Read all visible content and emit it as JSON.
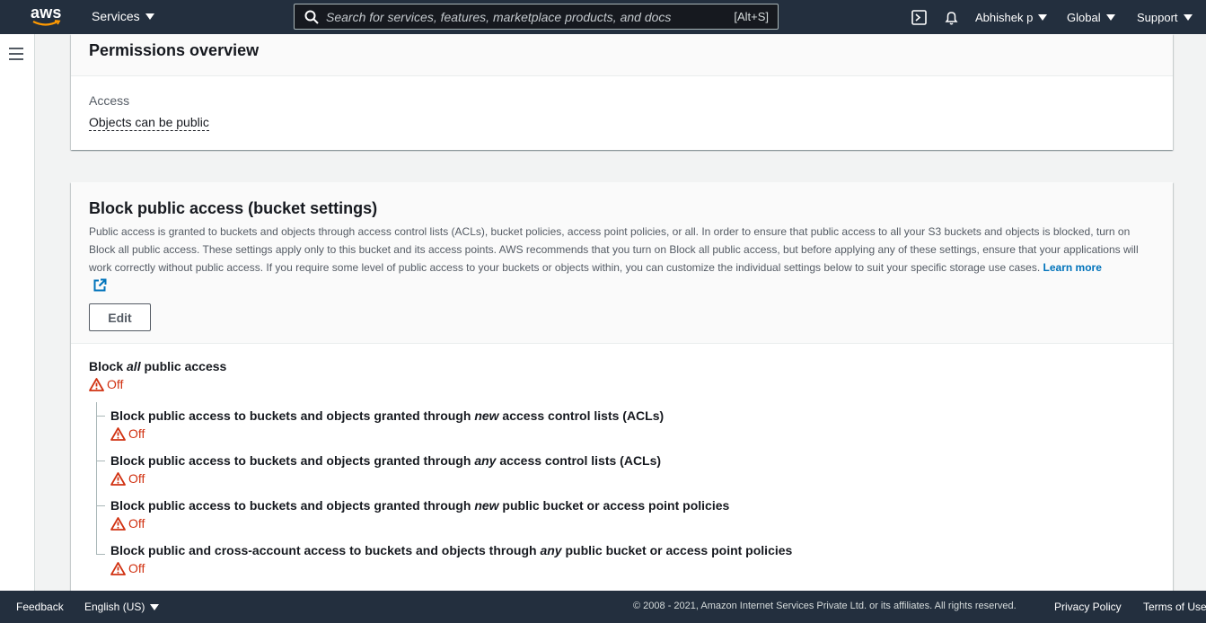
{
  "topnav": {
    "logo_text": "aws",
    "services_label": "Services",
    "search_placeholder": "Search for services, features, marketplace products, and docs",
    "search_shortcut": "[Alt+S]",
    "user_label": "Abhishek p",
    "region_label": "Global",
    "support_label": "Support",
    "icons": [
      "cloudshell-icon",
      "bell-icon"
    ]
  },
  "permissions_overview": {
    "title": "Permissions overview",
    "access_label": "Access",
    "access_value": "Objects can be public"
  },
  "block_public_access": {
    "title": "Block public access (bucket settings)",
    "description": "Public access is granted to buckets and objects through access control lists (ACLs), bucket policies, access point policies, or all. In order to ensure that public access to all your S3 buckets and objects is blocked, turn on Block all public access. These settings apply only to this bucket and its access points. AWS recommends that you turn on Block all public access, but before applying any of these settings, ensure that your applications will work correctly without public access. If you require some level of public access to your buckets or objects within, you can customize the individual settings below to suit your specific storage use cases.",
    "learn_more": "Learn more",
    "edit_label": "Edit",
    "all": {
      "pre": "Block ",
      "em": "all",
      "post": " public access",
      "status": "Off"
    },
    "settings": [
      {
        "pre": "Block public access to buckets and objects granted through ",
        "em": "new",
        "post": " access control lists (ACLs)",
        "status": "Off"
      },
      {
        "pre": "Block public access to buckets and objects granted through ",
        "em": "any",
        "post": " access control lists (ACLs)",
        "status": "Off"
      },
      {
        "pre": "Block public access to buckets and objects granted through ",
        "em": "new",
        "post": " public bucket or access point policies",
        "status": "Off"
      },
      {
        "pre": "Block public and cross-account access to buckets and objects through ",
        "em": "any",
        "post": " public bucket or access point policies",
        "status": "Off"
      }
    ]
  },
  "footer": {
    "feedback": "Feedback",
    "language": "English (US)",
    "copyright": "© 2008 - 2021, Amazon Internet Services Private Ltd. or its affiliates. All rights reserved.",
    "privacy": "Privacy Policy",
    "terms": "Terms of Use"
  },
  "colors": {
    "nav_bg": "#232f3e",
    "warning": "#d13212",
    "link": "#0073bb"
  }
}
